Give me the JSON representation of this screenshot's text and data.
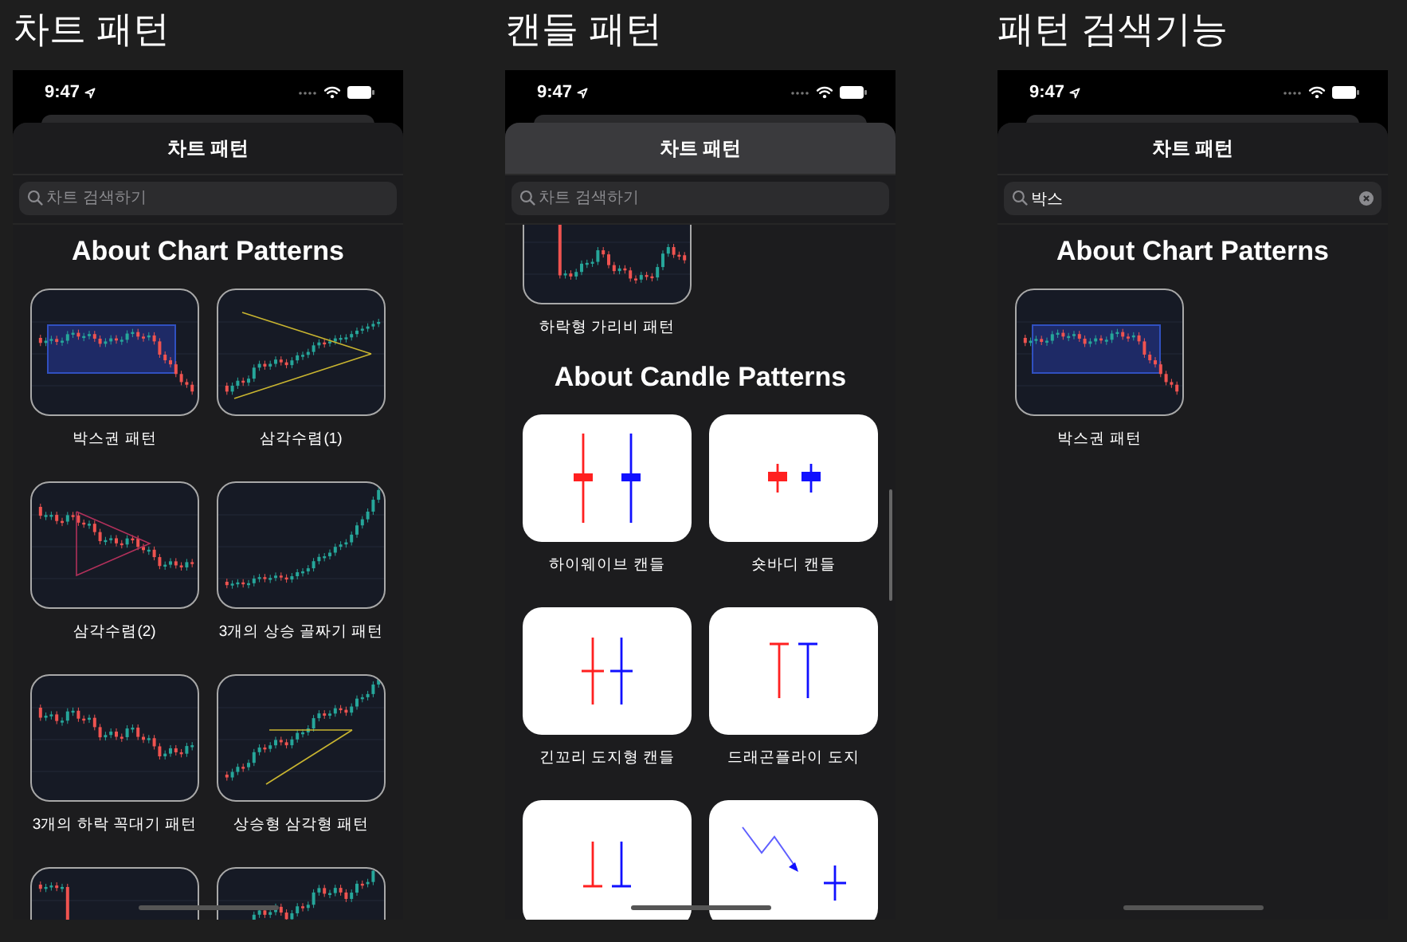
{
  "panels": [
    {
      "caption": "차트 패턴",
      "time": "9:47",
      "header": "차트 패턴",
      "scrolled": false,
      "search": {
        "placeholder": "차트 검색하기"
      },
      "sections": [
        {
          "kind": "chart",
          "title": "About Chart Patterns",
          "items": [
            {
              "kind": "box",
              "label": "박스권 패턴"
            },
            {
              "kind": "symmetric-triangle",
              "label": "삼각수렴(1)"
            },
            {
              "kind": "falling-triangle",
              "label": "삼각수렴(2)"
            },
            {
              "kind": "rising-valleys",
              "label": "3개의 상승 골짜기 패턴"
            },
            {
              "kind": "falling-peaks",
              "label": "3개의 하락 꼭대기 패턴"
            },
            {
              "kind": "ascending-triangle",
              "label": "상승형 삼각형 패턴"
            },
            {
              "kind": "drop"
            },
            {
              "kind": "rise"
            }
          ]
        }
      ]
    },
    {
      "caption": "캔들 패턴",
      "time": "9:47",
      "header": "차트 패턴",
      "scrolled": true,
      "search": {
        "placeholder": "차트 검색하기"
      },
      "sections": [
        {
          "kind": "chart",
          "items": [
            {
              "kind": "drop",
              "label": "하락형 가리비 패턴"
            }
          ]
        },
        {
          "kind": "candle",
          "title": "About Candle Patterns",
          "items": [
            {
              "kind": "high-wave",
              "label": "하이웨이브 캔들"
            },
            {
              "kind": "short-body",
              "label": "숏바디 캔들"
            },
            {
              "kind": "long-legged-doji",
              "label": "긴꼬리 도지형 캔들"
            },
            {
              "kind": "dragonfly-doji",
              "label": "드래곤플라이 도지"
            },
            {
              "kind": "gravestone-doji"
            },
            {
              "kind": "trend-doji"
            }
          ]
        }
      ]
    },
    {
      "caption": "패턴 검색기능",
      "time": "9:47",
      "header": "차트 패턴",
      "scrolled": false,
      "search": {
        "value": "박스"
      },
      "sections": [
        {
          "kind": "chart",
          "title": "About Chart Patterns",
          "items": [
            {
              "kind": "box",
              "label": "박스권 패턴"
            }
          ]
        }
      ]
    }
  ]
}
